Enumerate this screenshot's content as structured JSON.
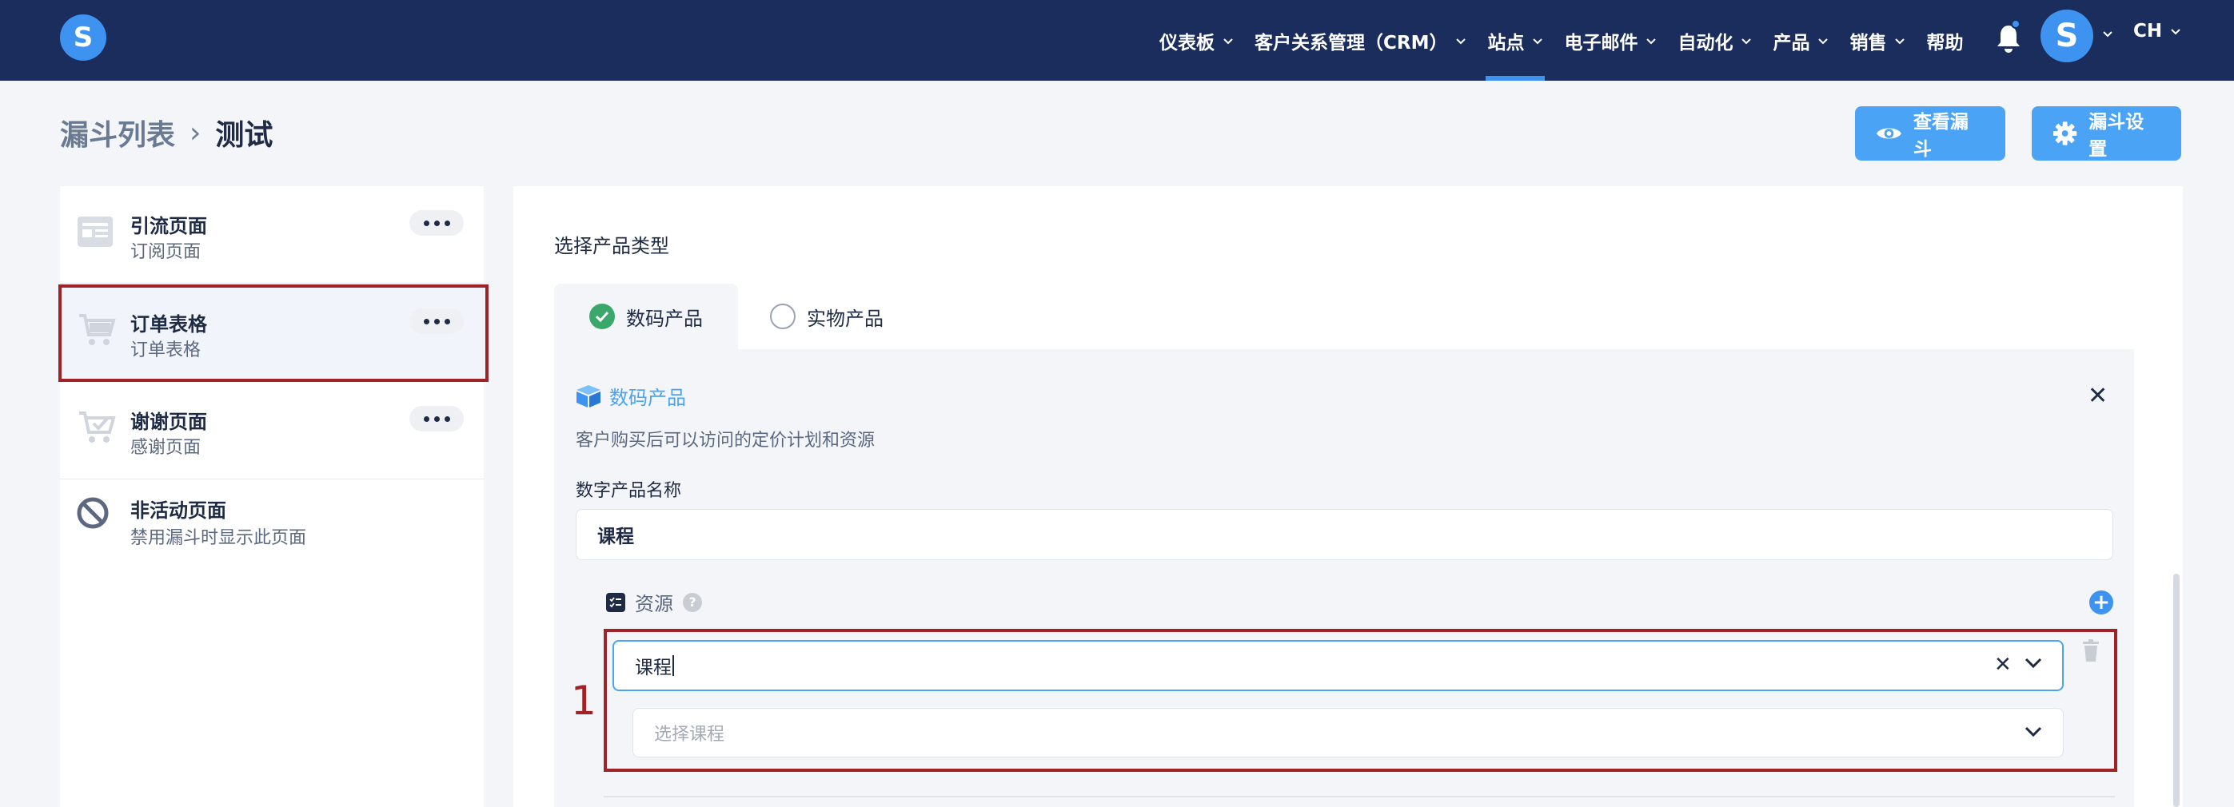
{
  "app": {
    "logo_letter": "S"
  },
  "nav": {
    "items": [
      {
        "label": "仪表板",
        "has_menu": true
      },
      {
        "label": "客户关系管理（CRM）",
        "has_menu": true
      },
      {
        "label": "站点",
        "has_menu": true,
        "active": true
      },
      {
        "label": "电子邮件",
        "has_menu": true
      },
      {
        "label": "自动化",
        "has_menu": true
      },
      {
        "label": "产品",
        "has_menu": true
      },
      {
        "label": "销售",
        "has_menu": true
      },
      {
        "label": "帮助",
        "has_menu": false
      }
    ],
    "avatar_letter": "S",
    "user_initials": "CH"
  },
  "breadcrumb": {
    "root": "漏斗列表",
    "separator": "›",
    "current": "测试"
  },
  "actions": {
    "view_funnel": "查看漏斗",
    "funnel_settings": "漏斗设置"
  },
  "steps": [
    {
      "title": "引流页面",
      "subtitle": "订阅页面",
      "icon": "layout-icon"
    },
    {
      "title": "订单表格",
      "subtitle": "订单表格",
      "icon": "cart-icon",
      "selected": true
    },
    {
      "title": "谢谢页面",
      "subtitle": "感谢页面",
      "icon": "cart-check-icon"
    },
    {
      "title": "非活动页面",
      "subtitle": "禁用漏斗时显示此页面",
      "icon": "ban-icon"
    }
  ],
  "product": {
    "type_label": "选择产品类型",
    "tabs": {
      "digital": "数码产品",
      "physical": "实物产品"
    },
    "selected_tab": "digital",
    "heading": "数码产品",
    "description": "客户购买后可以访问的定价计划和资源",
    "name_label": "数字产品名称",
    "name_value": "课程",
    "resources_label": "资源",
    "resource_select_value": "课程",
    "course_placeholder": "选择课程",
    "annotation_number": "1"
  },
  "colors": {
    "nav_bg": "#1a2d5c",
    "accent": "#3d93ef",
    "button_blue": "#4aa3f5",
    "highlight_red": "#9e2226",
    "check_green": "#3aa86b"
  }
}
